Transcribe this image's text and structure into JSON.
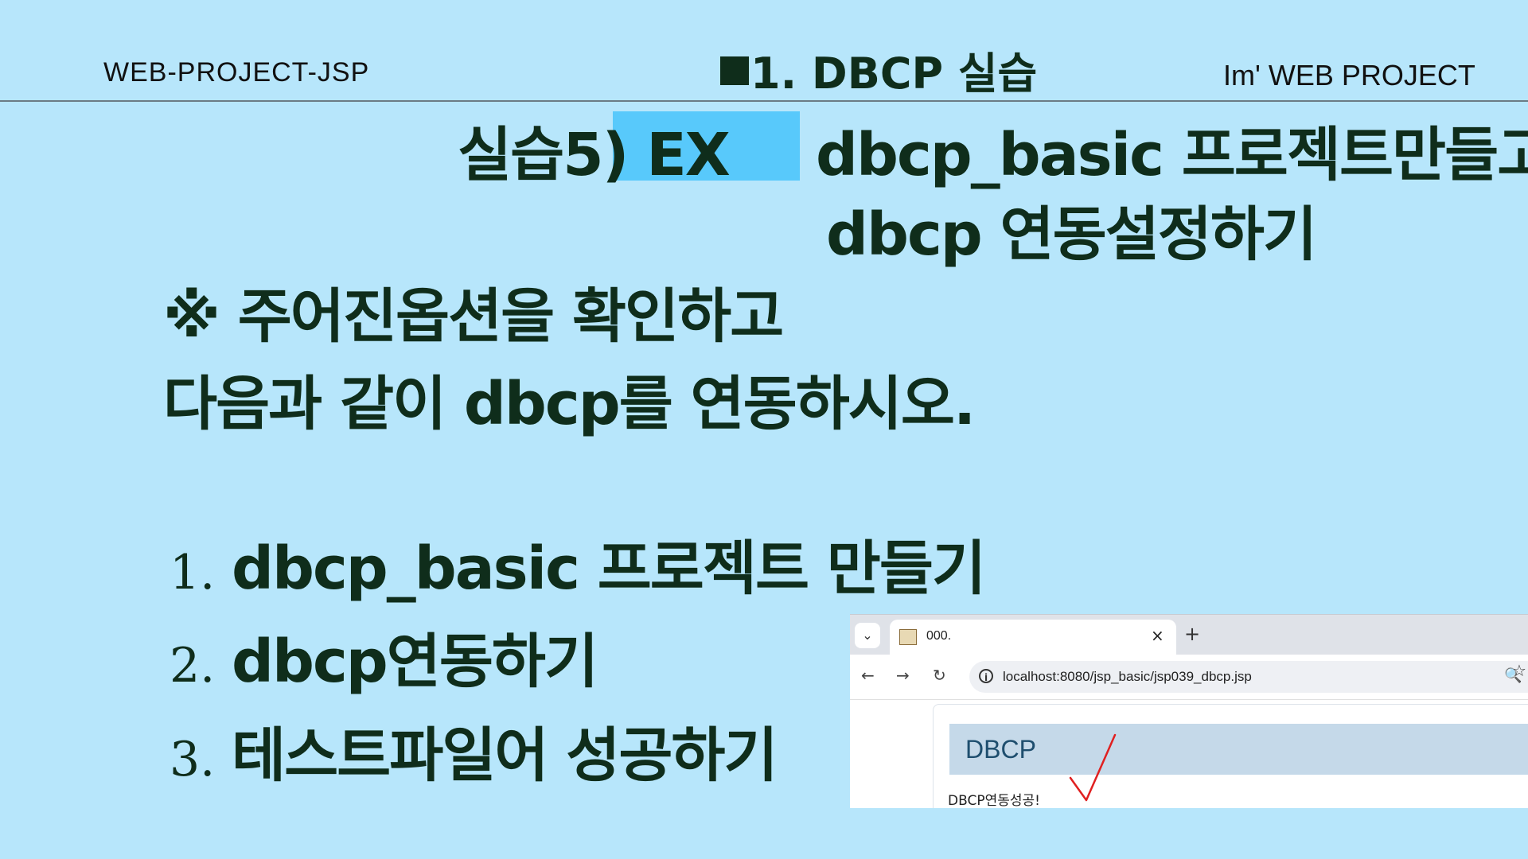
{
  "header": {
    "left": "WEB-PROJECT-JSP",
    "center": "1. DBCP 실습",
    "right": "Im'  WEB PROJECT"
  },
  "title": {
    "practice_label": "실습5)",
    "ex_label": "EX",
    "line1": "dbcp_basic 프로젝트만들고",
    "line2": "dbcp 연동설정하기"
  },
  "instruction": {
    "line1": "※ 주어진옵션을 확인하고",
    "line2": "다음과 같이 dbcp를 연동하시오."
  },
  "steps": [
    {
      "num": "1.",
      "text": "dbcp_basic 프로젝트 만들기"
    },
    {
      "num": "2.",
      "text": "dbcp연동하기"
    },
    {
      "num": "3.",
      "text": "테스트파일어 성공하기"
    }
  ],
  "browser": {
    "tab_title": "000.",
    "tab_close": "×",
    "new_tab": "+",
    "url": "localhost:8080/jsp_basic/jsp039_dbcp.jsp",
    "page_heading": "DBCP",
    "page_message": "DBCP연동성공!"
  },
  "colors": {
    "background": "#b7e6fb",
    "highlight": "#58c9fb",
    "text": "#0f2d1b"
  }
}
